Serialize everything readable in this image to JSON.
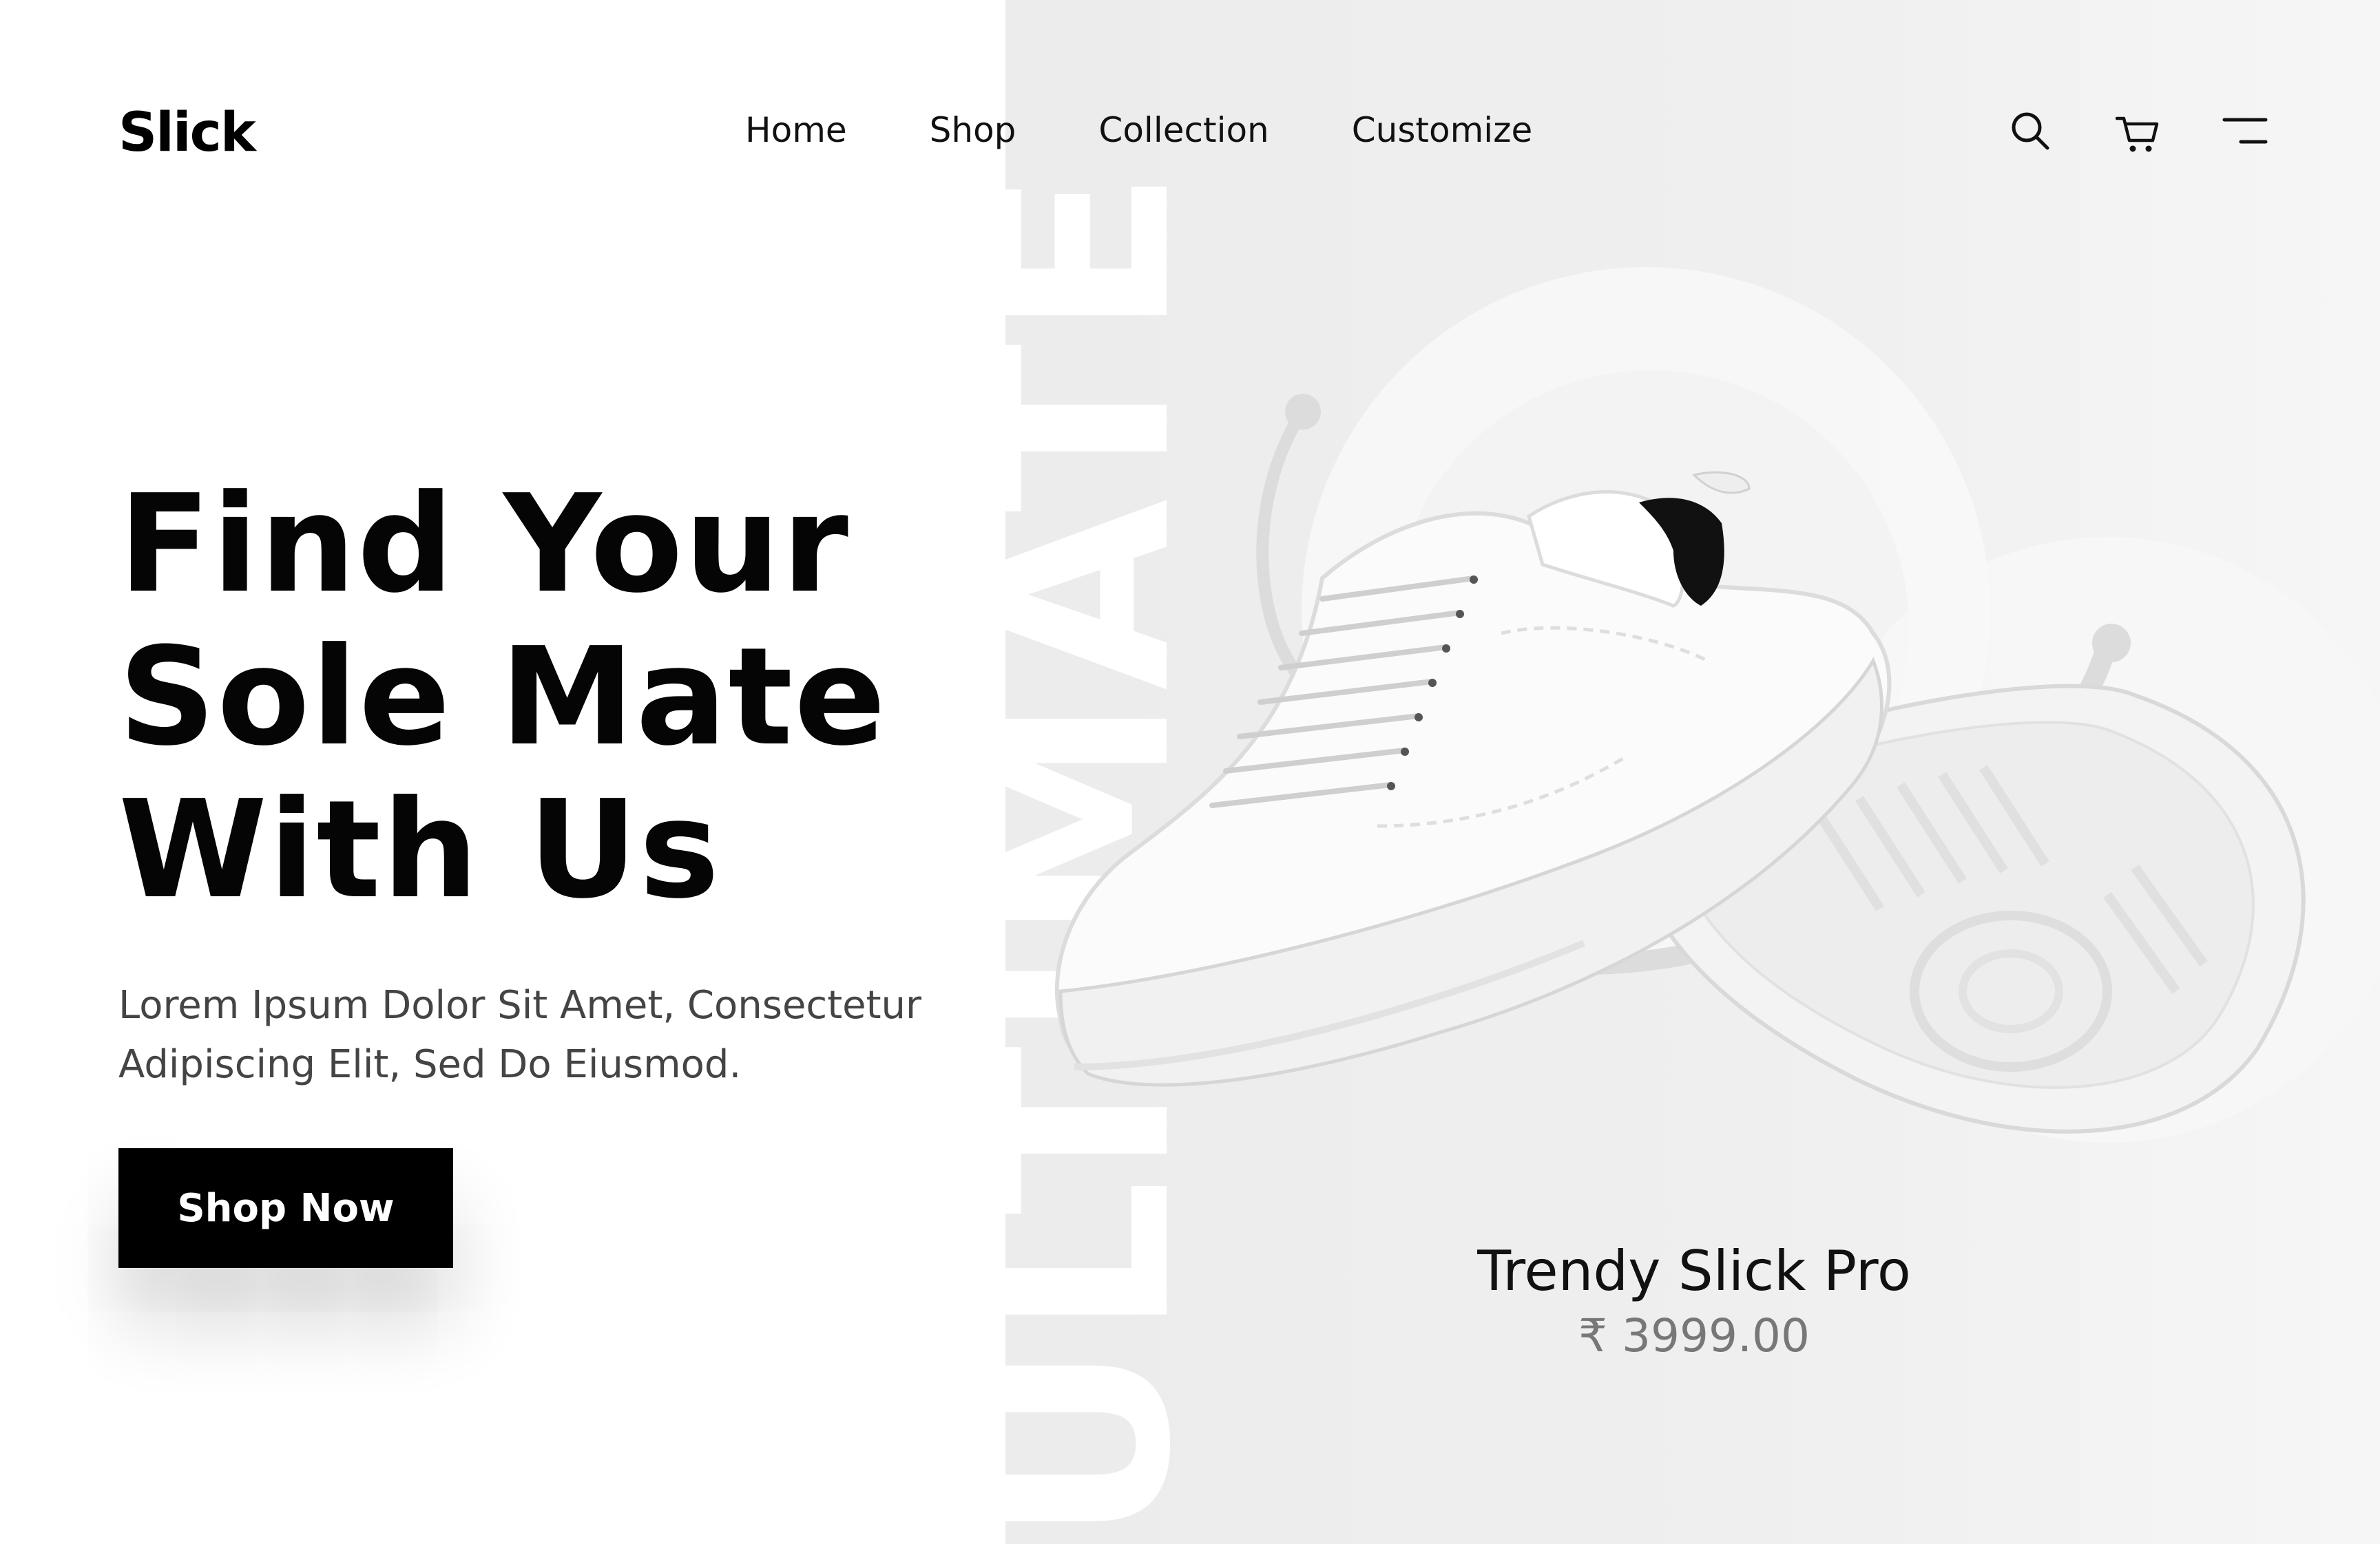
{
  "brand": {
    "logo": "Slick"
  },
  "nav": {
    "items": [
      "Home",
      "Shop",
      "Collection",
      "Customize"
    ]
  },
  "header_icons": [
    "search-icon",
    "cart-icon",
    "menu-icon"
  ],
  "hero": {
    "headline": [
      "Find Your",
      "Sole Mate",
      "With Us"
    ],
    "subtitle": [
      "Lorem Ipsum Dolor Sit Amet, Consectetur",
      "Adipiscing Elit, Sed Do Eiusmod."
    ],
    "cta_label": "Shop Now",
    "background_word": "ULTIMATE"
  },
  "product": {
    "name": "Trendy Slick Pro",
    "price": "₹ 3999.00"
  },
  "colors": {
    "primary": "#000000",
    "panel_bg": "#ececec",
    "text_muted": "#777777"
  }
}
